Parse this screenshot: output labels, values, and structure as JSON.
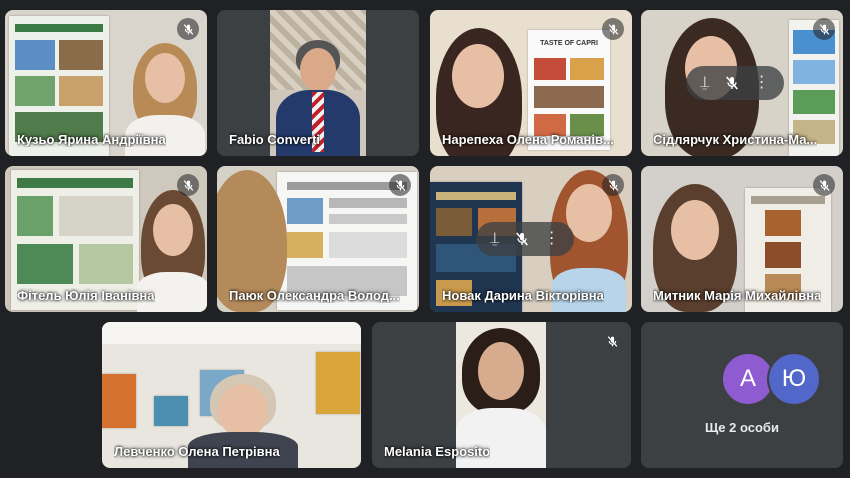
{
  "participants": [
    {
      "name": "Кузьо Ярина Андріївна",
      "muted": true
    },
    {
      "name": "Fabio Converti",
      "muted": false
    },
    {
      "name": "Нарепеха Олена Романів...",
      "muted": true
    },
    {
      "name": "Сідлярчук Христина-Ма...",
      "muted": true
    },
    {
      "name": "Фітель Юлія Іванівна",
      "muted": true
    },
    {
      "name": "Паюк Олександра Волод...",
      "muted": true
    },
    {
      "name": "Новак Дарина Вікторівна",
      "muted": true
    },
    {
      "name": "Митник Марія Михайлівна",
      "muted": true
    },
    {
      "name": "Левченко Олена Петрівна",
      "muted": false
    },
    {
      "name": "Melania Esposito",
      "muted": true
    }
  ],
  "poster_title": "TASTE OF CAPRI",
  "others": {
    "avatars": [
      {
        "letter": "А",
        "color": "#8e5bd0"
      },
      {
        "letter": "Ю",
        "color": "#5167c9"
      }
    ],
    "label": "Ще 2 особи"
  },
  "tile_actions": {
    "pin": "pin-icon",
    "mute": "mic-off-icon",
    "more": "more-vert-icon"
  },
  "colors": {
    "background": "#202124",
    "tile": "#3c4043",
    "avatar_a": "#8e5bd0",
    "avatar_yu": "#5167c9"
  }
}
